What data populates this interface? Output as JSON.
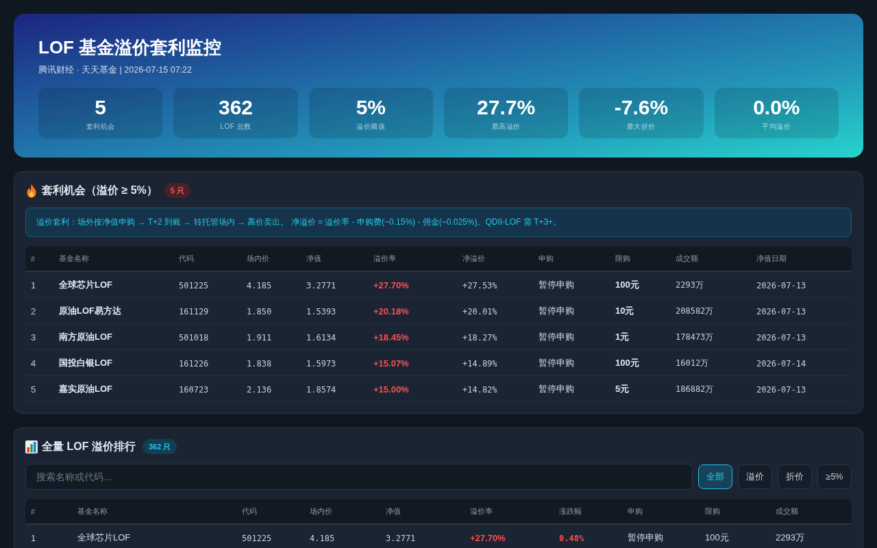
{
  "header": {
    "title": "LOF 基金溢价套利监控",
    "subtitle": "腾讯财经 · 天天基金 | 2026-07-15 07:22",
    "stats": [
      {
        "value": "5",
        "label": "套利机会"
      },
      {
        "value": "362",
        "label": "LOF 总数"
      },
      {
        "value": "5%",
        "label": "溢价阈值"
      },
      {
        "value": "27.7%",
        "label": "最高溢价"
      },
      {
        "value": "-7.6%",
        "label": "最大折价"
      },
      {
        "value": "0.0%",
        "label": "平均溢价"
      }
    ]
  },
  "opportunities": {
    "title": "套利机会（溢价 ≥ 5%）",
    "badge": "5 只",
    "note": "溢价套利：场外按净值申购 → T+2 到账 → 转托管场内 → 高价卖出。 净溢价 = 溢价率 - 申购费(~0.15%) - 佣金(~0.025%)。QDII-LOF 需 T+3+。",
    "table": {
      "columns": [
        {
          "label": "#",
          "kind": "index"
        },
        {
          "label": "基金名称",
          "kind": "strong"
        },
        {
          "label": "代码",
          "kind": "mono"
        },
        {
          "label": "场内价",
          "kind": "mono"
        },
        {
          "label": "净值",
          "kind": "mono"
        },
        {
          "label": "溢价率",
          "kind": "premium"
        },
        {
          "label": "净溢价",
          "kind": "mono"
        },
        {
          "label": "申购",
          "kind": "plain"
        },
        {
          "label": "限购",
          "kind": "strong"
        },
        {
          "label": "成交额",
          "kind": "mono"
        },
        {
          "label": "净值日期",
          "kind": "mono"
        }
      ],
      "rows": [
        [
          "1",
          "全球芯片LOF",
          "501225",
          "4.185",
          "3.2771",
          "+27.70%",
          "+27.53%",
          "暂停申购",
          "100元",
          "2293万",
          "2026-07-13"
        ],
        [
          "2",
          "原油LOF易方达",
          "161129",
          "1.850",
          "1.5393",
          "+20.18%",
          "+20.01%",
          "暂停申购",
          "10元",
          "208582万",
          "2026-07-13"
        ],
        [
          "3",
          "南方原油LOF",
          "501018",
          "1.911",
          "1.6134",
          "+18.45%",
          "+18.27%",
          "暂停申购",
          "1元",
          "178473万",
          "2026-07-13"
        ],
        [
          "4",
          "国投白银LOF",
          "161226",
          "1.838",
          "1.5973",
          "+15.07%",
          "+14.89%",
          "暂停申购",
          "100元",
          "16012万",
          "2026-07-14"
        ],
        [
          "5",
          "嘉实原油LOF",
          "160723",
          "2.136",
          "1.8574",
          "+15.00%",
          "+14.82%",
          "暂停申购",
          "5元",
          "186882万",
          "2026-07-13"
        ]
      ]
    }
  },
  "ranking": {
    "title": "全量 LOF 溢价排行",
    "badge": "362 只",
    "search": {
      "placeholder": "搜索名称或代码..."
    },
    "filters": [
      {
        "label": "全部",
        "selected": true
      },
      {
        "label": "溢价",
        "selected": false
      },
      {
        "label": "折价",
        "selected": false
      },
      {
        "label": "≥5%",
        "selected": false
      }
    ],
    "table": {
      "columns": [
        {
          "label": "#",
          "kind": "index"
        },
        {
          "label": "基金名称",
          "kind": "plain"
        },
        {
          "label": "代码",
          "kind": "mono"
        },
        {
          "label": "场内价",
          "kind": "mono"
        },
        {
          "label": "净值",
          "kind": "mono"
        },
        {
          "label": "溢价率",
          "kind": "premium"
        },
        {
          "label": "涨跌幅",
          "kind": "change"
        },
        {
          "label": "申购",
          "kind": "plain"
        },
        {
          "label": "限购",
          "kind": "plain"
        },
        {
          "label": "成交额",
          "kind": "plain"
        }
      ],
      "rows": [
        [
          "1",
          "全球芯片LOF",
          "501225",
          "4.185",
          "3.2771",
          "+27.70%",
          "0.48%",
          "暂停申购",
          "100元",
          "2293万"
        ]
      ]
    }
  }
}
